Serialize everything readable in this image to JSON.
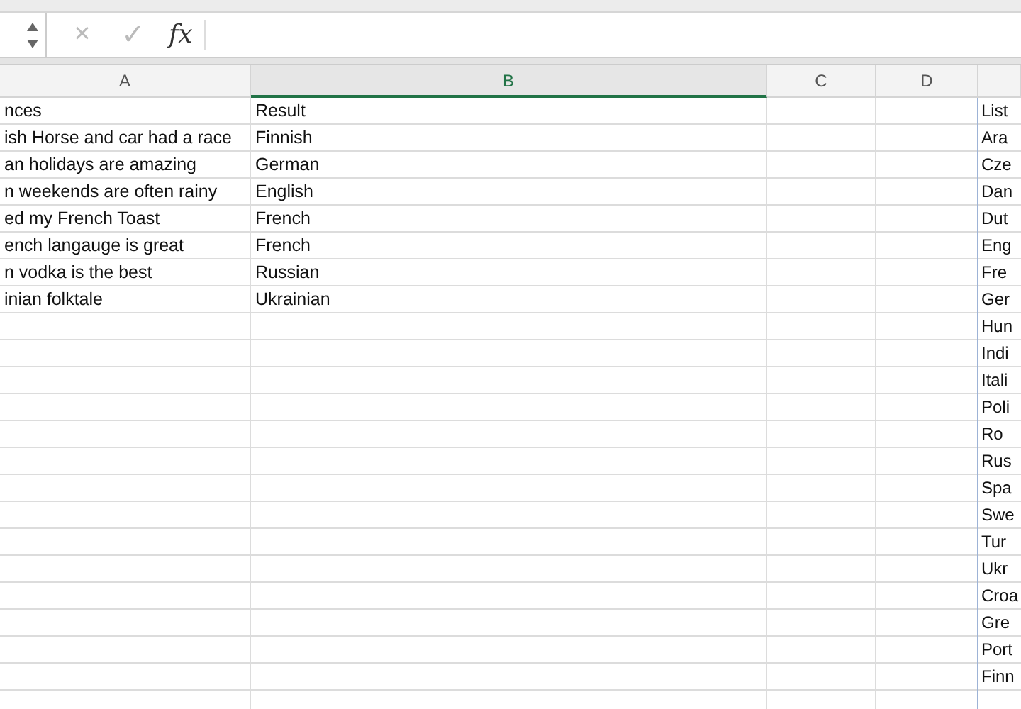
{
  "formula_bar": {
    "cancel": "×",
    "enter": "✓",
    "fx": "fx"
  },
  "columns": [
    {
      "label": "A",
      "selected": false
    },
    {
      "label": "B",
      "selected": true
    },
    {
      "label": "C",
      "selected": false
    },
    {
      "label": "D",
      "selected": false
    }
  ],
  "rows": [
    {
      "a": "nces",
      "b": "Result",
      "e": "List"
    },
    {
      "a": "ish Horse and car had a race",
      "b": "Finnish",
      "e": "Ara"
    },
    {
      "a": "an holidays are amazing",
      "b": "German",
      "e": "Cze"
    },
    {
      "a": "n weekends are often rainy",
      "b": "English",
      "e": "Dan"
    },
    {
      "a": "ed my French Toast",
      "b": "French",
      "e": "Dut"
    },
    {
      "a": "ench langauge is great",
      "b": "French",
      "e": "Eng"
    },
    {
      "a": "n vodka is the best",
      "b": "Russian",
      "e": "Fre"
    },
    {
      "a": "inian folktale",
      "b": "Ukrainian",
      "e": "Ger"
    },
    {
      "e": "Hun"
    },
    {
      "e": "Indi"
    },
    {
      "e": "Itali"
    },
    {
      "e": "Poli"
    },
    {
      "e": "Ro"
    },
    {
      "e": "Rus"
    },
    {
      "e": "Spa"
    },
    {
      "e": "Swe"
    },
    {
      "e": "Tur"
    },
    {
      "e": "Ukr"
    },
    {
      "e": "Croa"
    },
    {
      "e": "Gre"
    },
    {
      "e": "Port"
    },
    {
      "e": "Finn"
    }
  ]
}
